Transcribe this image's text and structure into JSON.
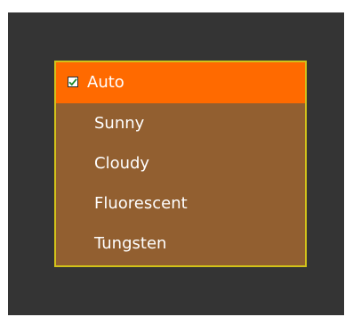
{
  "menu": {
    "items": [
      {
        "label": "Auto",
        "selected": true,
        "checked": true
      },
      {
        "label": "Sunny"
      },
      {
        "label": "Cloudy"
      },
      {
        "label": "Fluorescent"
      },
      {
        "label": "Tungsten"
      }
    ],
    "colors": {
      "background": "#343434",
      "menu_fill": "#925f30",
      "menu_border": "#d2c21a",
      "selected_fill": "#ff6a00",
      "text": "#ffffff",
      "check": "#1e8a2a"
    },
    "icons": {
      "selected_item_marker": "checkbox-checked-icon"
    }
  }
}
